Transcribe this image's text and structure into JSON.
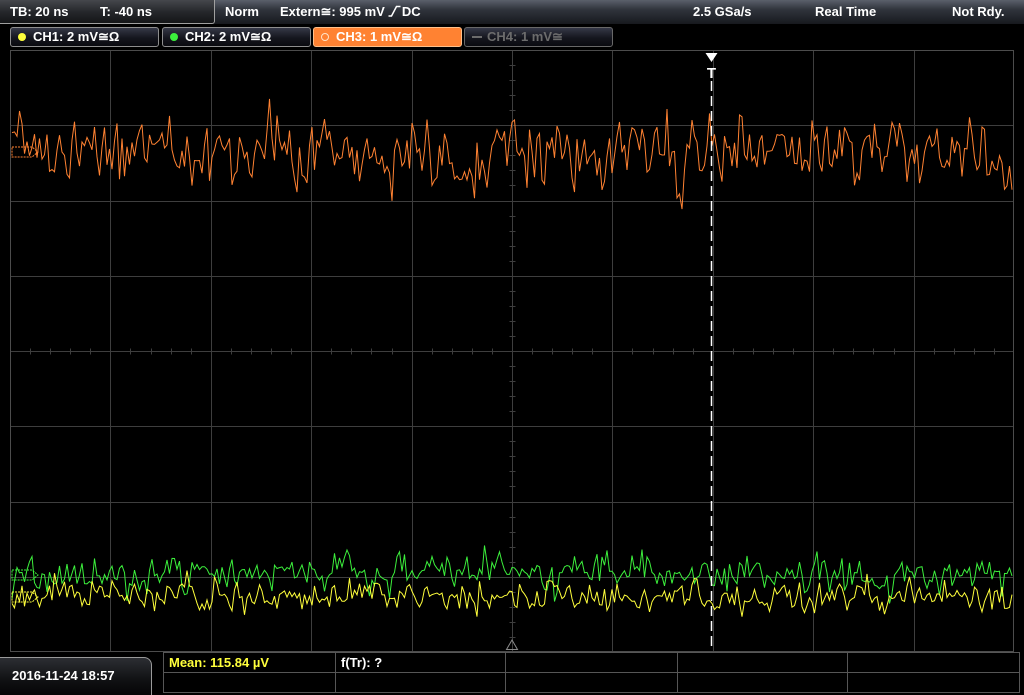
{
  "top_bar": {
    "timebase": "TB: 20 ns",
    "trigger_time": "T: -40 ns",
    "trigger_mode": "Norm",
    "trigger_source": "Extern≅: 995 mV",
    "trigger_slope_icon": "rising-edge-icon",
    "trigger_coupling": "DC",
    "sample_rate": "2.5 GSa/s",
    "acquisition_mode": "Real Time",
    "status": "Not Rdy."
  },
  "channels": [
    {
      "label": "CH1: 2 mV≅Ω",
      "color": "#ffff3c",
      "indicator_icon": "filled-dot-icon",
      "state": "on"
    },
    {
      "label": "CH2: 2 mV≅Ω",
      "color": "#3cf03c",
      "indicator_icon": "filled-dot-icon",
      "state": "on"
    },
    {
      "label": "CH3: 1 mV≅Ω",
      "color": "#ff8232",
      "indicator_icon": "ring-icon",
      "state": "selected"
    },
    {
      "label": "CH4: 1 mV≅",
      "color": "#6c6c6c",
      "indicator_icon": "dash-icon",
      "state": "off"
    }
  ],
  "display": {
    "trigger_marker_label": "T",
    "trigger_marker_icon": "trigger-arrow-icon",
    "horizontal_marker_icon": "triangle-up-icon"
  },
  "footer": {
    "datetime": "2016-11-24 18:57",
    "measurements": [
      {
        "text": "Mean: 115.84 µV",
        "color": "#ffff3c"
      },
      {
        "text": "f(Tr): ?",
        "color": "#ffffff"
      }
    ]
  },
  "colors": {
    "background": "#000000",
    "grid": "#3e3e3e",
    "grid_border": "#4c4c4c",
    "trigger_line": "#ffffff",
    "marker_grey": "#8a8a8a"
  }
}
